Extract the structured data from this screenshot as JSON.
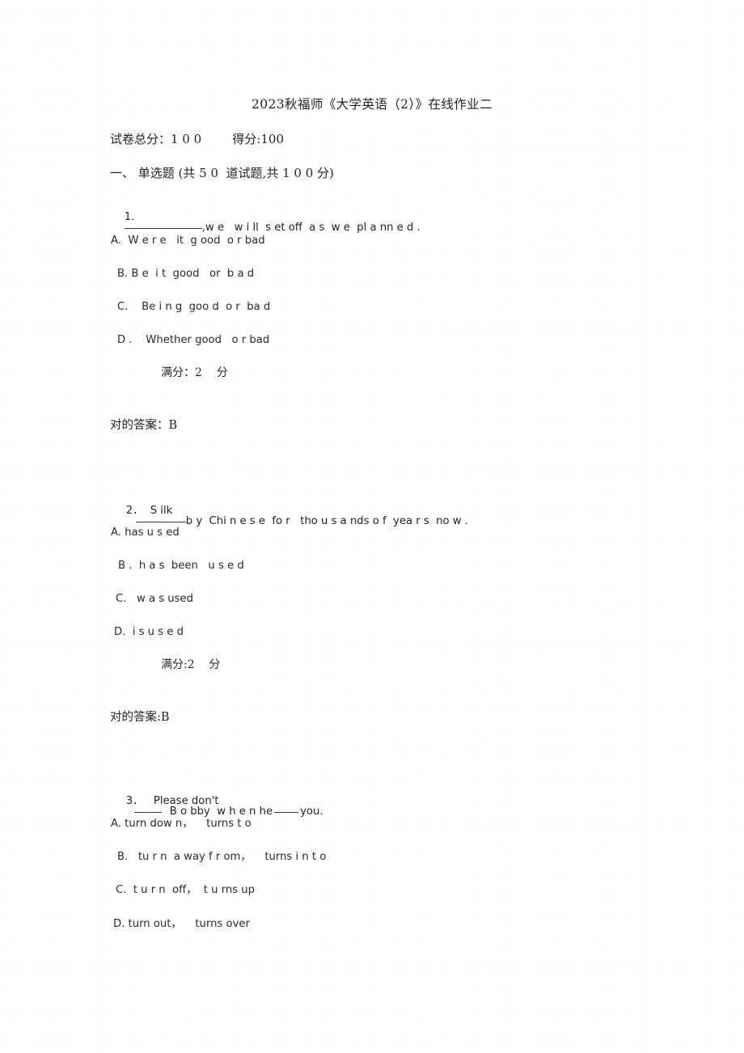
{
  "document": {
    "title": "2023秋福师《大学英语（2）》在线作业二",
    "score_line": "试卷总分：1 0 0        得分:100",
    "section_heading": "一、 单选题 (共 5 0  道试题,共 1 0 0 分)"
  },
  "questions": [
    {
      "number": "1.",
      "stem_before_blank": "1.",
      "stem_after_blank": ",w e   w i ll  s et off  a s  w e  pl a nn e d .",
      "options": [
        {
          "label": "A.",
          "text": "A.  W e r e   it  g ood  o r bad"
        },
        {
          "label": "B.",
          "text": "B. B e  i t  good   or  b a d"
        },
        {
          "label": "C.",
          "text": "C.    Be i n g  goo d  o r  ba d"
        },
        {
          "label": "D.",
          "text": "D .    Whether good   o r bad"
        }
      ],
      "full_mark": "满分：2    分",
      "answer": "对的答案：B"
    },
    {
      "number": "2．",
      "stem_before_blank": "2．  S ilk",
      "stem_after_blank": "b y  Chi n e s e  fo r   tho u s a nds o f  yea r s  no w .",
      "options": [
        {
          "label": "A.",
          "text": "A. has u s ed"
        },
        {
          "label": "B.",
          "text": "B .  h a s  been   u s e d"
        },
        {
          "label": "C.",
          "text": "C.   w a s used"
        },
        {
          "label": "D.",
          "text": "D.  i s u s e d"
        }
      ],
      "full_mark": "满分:2    分",
      "answer": "对的答案:B"
    },
    {
      "number": "3．",
      "stem_part1": "3．   Please don't",
      "stem_part2": "B o bby  w h e n he",
      "stem_part3": "you.",
      "options": [
        {
          "label": "A.",
          "text": "A. turn dow n，    turns t o"
        },
        {
          "label": "B.",
          "text": "B.   tu r n  a way f r om，    turns i n t o"
        },
        {
          "label": "C.",
          "text": "C.  t u r n  off，  t u rns up"
        },
        {
          "label": "D.",
          "text": "D. turn out，    turns over"
        }
      ]
    }
  ]
}
